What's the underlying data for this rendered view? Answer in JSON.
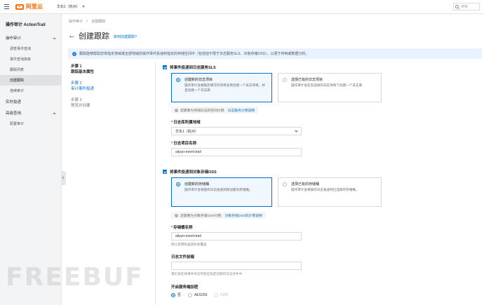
{
  "topbar": {
    "logo_text": "阿里云",
    "region": "华东1（杭州）",
    "search_placeholder": "搜索"
  },
  "sidebar": {
    "title": "操作审计 ActionTrail",
    "groups": [
      {
        "label": "操作审计",
        "items": [
          "调查事件查询",
          "事件查询高级",
          "跟踪列表",
          "创建跟踪",
          "连续审计"
        ]
      },
      {
        "label": "实时投递",
        "items": []
      },
      {
        "label": "高级查询",
        "items": [
          "配置审计"
        ]
      }
    ]
  },
  "breadcrumb": [
    "操作审计",
    "/",
    "创建跟踪"
  ],
  "page": {
    "title": "创建跟踪",
    "help_link": "如何创建跟踪?"
  },
  "notice": "跟踪能够帮助您将指定地域或全部地域的操作事件投递到指定的存储空间中（包括但不限于日志服务SLS、对象存储OSS），以便于存档或数据分析。",
  "steps": [
    {
      "label": "步骤 1",
      "name": "跟踪基本属性"
    },
    {
      "label": "步骤 2",
      "name": "审计事件投递"
    },
    {
      "label": "步骤 3",
      "name": "预览并创建"
    }
  ],
  "sls": {
    "checkbox_label": "将事件投递到日志服务SLS",
    "card_new_title": "创建新的日志项目",
    "card_new_desc": "操作审计会根据您填写的项目名称创建一个日志项目，并且创建一个日志库",
    "card_exist_title": "选择已有的日志项目",
    "card_exist_desc": "操作审计会在您选择的日志项目下创建一个日志库",
    "cost_text": "您需要为存储日志的空间付费:",
    "cost_link": "日志服务计费说明",
    "region_label": "日志库所属地域",
    "region_value": "华东1（杭州）",
    "project_label": "日志项目名称",
    "project_value": "aliyun-event-trail"
  },
  "oss": {
    "checkbox_label": "将事件投递到对象存储OSS",
    "card_new_title": "创建新的存储桶",
    "card_new_desc": "操作审计会将操作日志投递到新创建的存储桶。",
    "card_exist_title": "选择已有的存储桶",
    "card_exist_desc": "操作审计会将操作日志投递到已选择的存储桶。",
    "cost_text": "您需要为对象存储OSS付费:",
    "cost_link": "对象存储OSS的计费说明",
    "bucket_label": "存储桶名称",
    "bucket_value": "aliyun-event-trail",
    "bucket_hint": "默认启用防盗链和防覆盖",
    "prefix_label": "日志文件前缀",
    "prefix_value": "",
    "prefix_hint": "我们会在将事件日志存放在指定前缀的日志文件中",
    "encryption_label": "开启服务端加密",
    "encryption_options": [
      "否",
      "AES256",
      "KMS"
    ]
  },
  "watermark": "FREEBUF"
}
